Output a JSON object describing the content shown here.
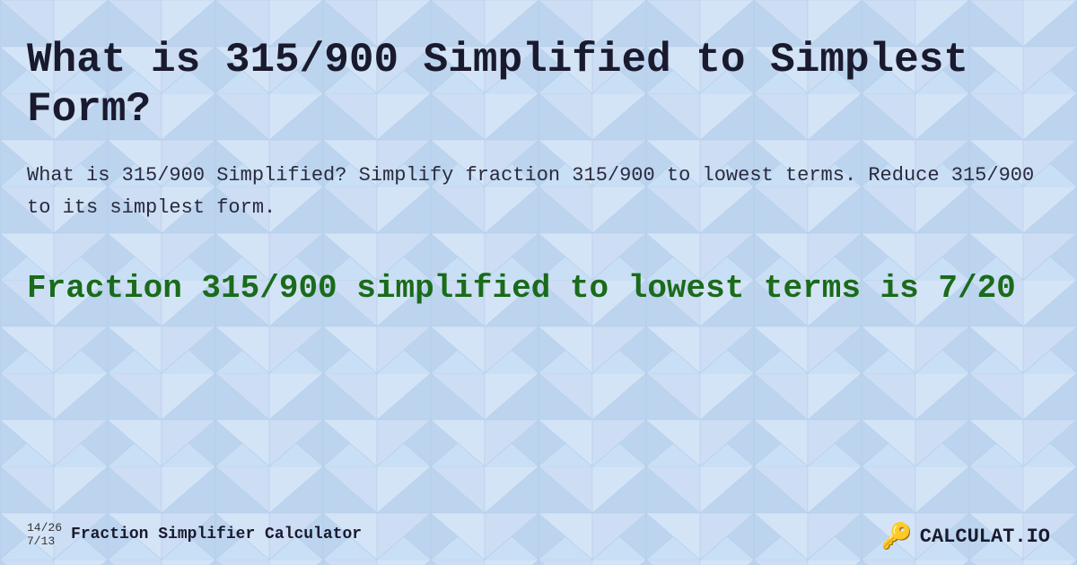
{
  "background": {
    "color": "#c8dff5"
  },
  "main_title": "What is 315/900 Simplified to Simplest Form?",
  "description": "What is 315/900 Simplified? Simplify fraction 315/900 to lowest terms. Reduce 315/900 to its simplest form.",
  "result": "Fraction 315/900 simplified to lowest terms is 7/20",
  "footer": {
    "fraction_top": "14/26",
    "fraction_bottom": "7/13",
    "label": "Fraction Simplifier Calculator",
    "logo_text": "CALCULAT.IO"
  }
}
